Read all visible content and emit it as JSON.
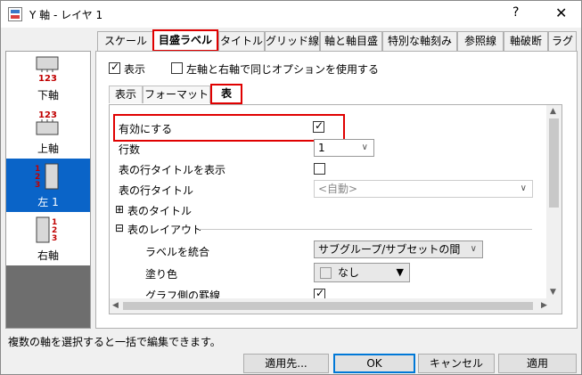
{
  "window": {
    "title": "Y 軸 - レイヤ 1",
    "help_label": "?",
    "close_label": "✕"
  },
  "axes": [
    {
      "label": "下軸",
      "icon": "bottom-axis-icon",
      "selected": false
    },
    {
      "label": "上軸",
      "icon": "top-axis-icon",
      "selected": false
    },
    {
      "label": "左 1",
      "icon": "left-axis-icon",
      "selected": true
    },
    {
      "label": "右軸",
      "icon": "right-axis-icon",
      "selected": false
    }
  ],
  "axis_tick_digits": [
    "1",
    "2",
    "3"
  ],
  "tabs": [
    "スケール",
    "目盛ラベル",
    "タイトル",
    "グリッド線",
    "軸と軸目盛",
    "特別な軸刻み",
    "参照線",
    "軸破断",
    "ラグ"
  ],
  "active_tab": "目盛ラベル",
  "options": {
    "show_label": "表示",
    "show_checked": true,
    "same_options_label": "左軸と右軸で同じオプションを使用する",
    "same_options_checked": false
  },
  "subtabs": [
    "表示",
    "フォーマット",
    "表"
  ],
  "active_subtab": "表",
  "rows": {
    "enable": {
      "label": "有効にする",
      "checked": true
    },
    "row_count": {
      "label": "行数",
      "value": "1"
    },
    "show_row_title": {
      "label": "表の行タイトルを表示",
      "checked": false
    },
    "row_title": {
      "label": "表の行タイトル",
      "value": "<自動>"
    },
    "table_title": {
      "label": "表のタイトル",
      "expander": "⊞"
    },
    "table_layout": {
      "label": "表のレイアウト",
      "expander": "⊟"
    },
    "merge_labels": {
      "label": "ラベルを統合",
      "value": "サブグループ/サブセットの間"
    },
    "fill_color": {
      "label": "塗り色",
      "value": "なし"
    },
    "graph_side_border": {
      "label": "グラフ側の罫線",
      "checked": true
    }
  },
  "status_text": "複数の軸を選択すると一括で編集できます。",
  "buttons": {
    "apply_to": "適用先...",
    "ok": "OK",
    "cancel": "キャンセル",
    "apply": "適用"
  },
  "colors": {
    "highlight": "#e00000",
    "selection": "#0a64c8",
    "tick_digit": "#c00000"
  }
}
